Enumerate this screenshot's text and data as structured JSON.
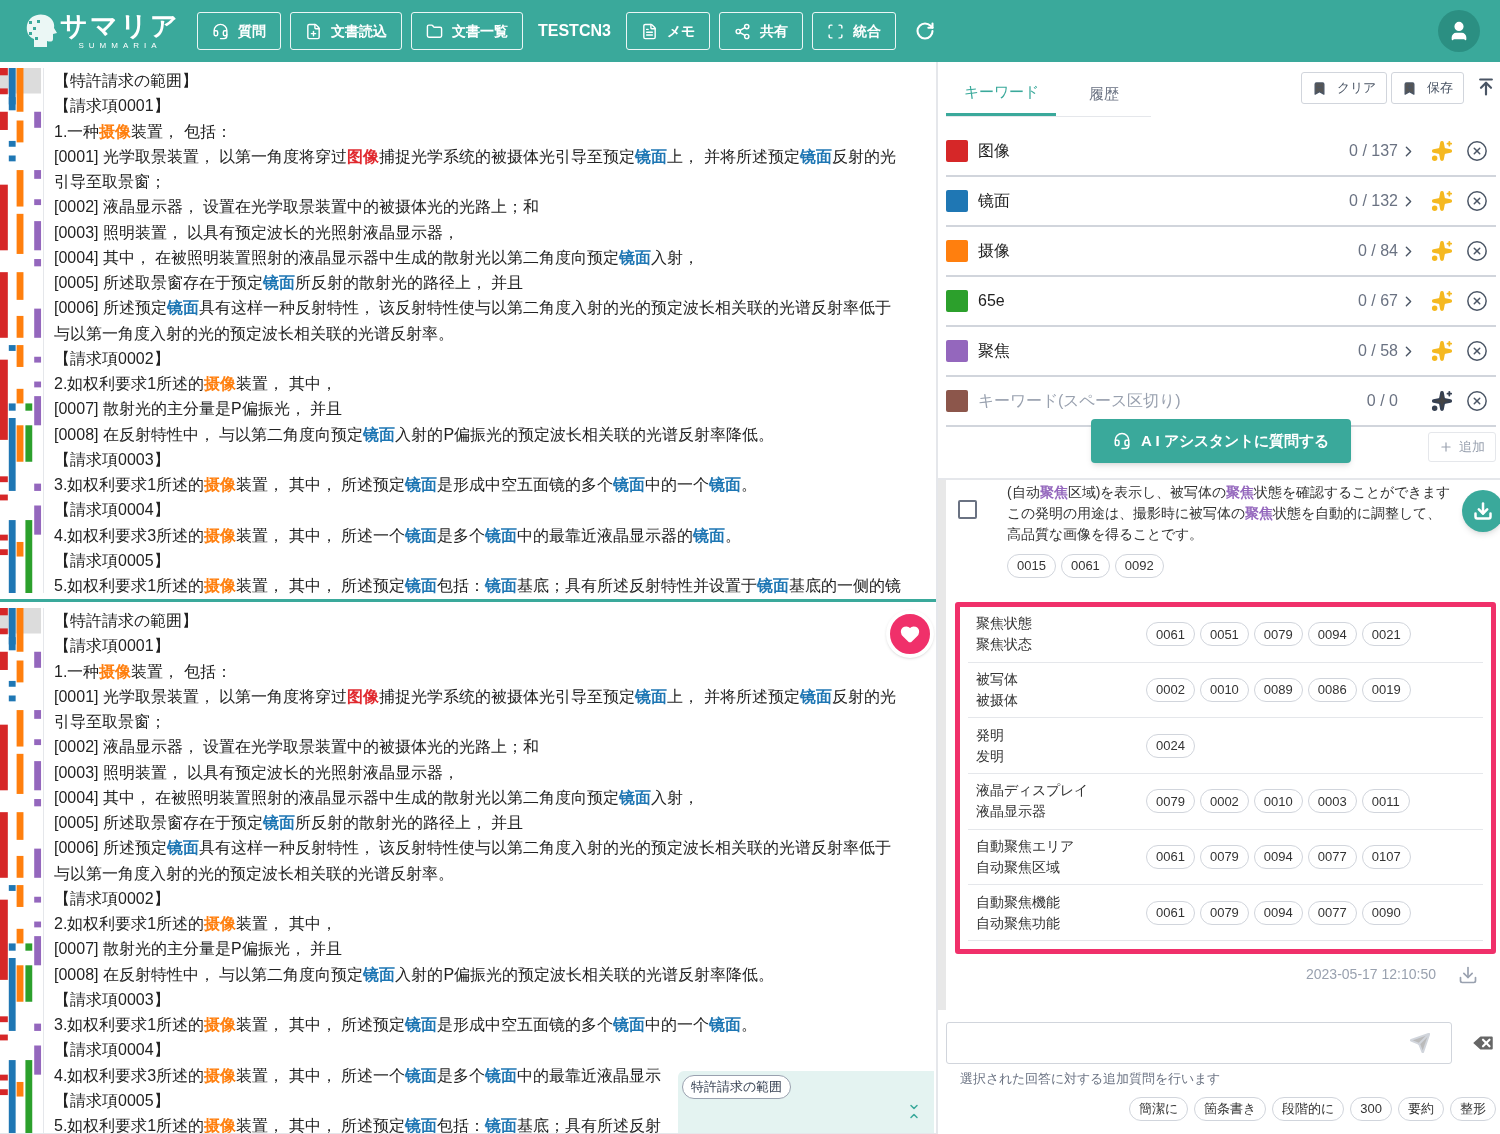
{
  "header": {
    "logo": {
      "name": "サマリア",
      "subtitle": "SUMMARIA"
    },
    "items": [
      {
        "kind": "button",
        "label": "質問"
      },
      {
        "kind": "button",
        "label": "文書読込"
      },
      {
        "kind": "button",
        "label": "文書一覧"
      },
      {
        "kind": "label",
        "label": "TESTCN3"
      },
      {
        "kind": "button",
        "label": "メモ"
      },
      {
        "kind": "button",
        "label": "共有"
      },
      {
        "kind": "button",
        "label": "統合"
      }
    ]
  },
  "documents": [
    {
      "selected": true,
      "lines": [
        [
          {
            "text": "【特許請求の範囲】"
          }
        ],
        [
          {
            "text": "【請求項0001】"
          }
        ],
        [
          {
            "text": "1.一种"
          },
          {
            "text": "摄像",
            "color": "#ff7f0e"
          },
          {
            "text": "装置， 包括："
          }
        ],
        [
          {
            "text": "[0001] 光学取景装置， 以第一角度将穿过"
          },
          {
            "text": "图像",
            "color": "#e0282e"
          },
          {
            "text": "捕捉光学系统的被摄体光引导至预定"
          },
          {
            "text": "镜面",
            "color": "#1f77b4"
          },
          {
            "text": "上， 并将所述预定"
          },
          {
            "text": "镜面",
            "color": "#1f77b4"
          },
          {
            "text": "反射的光"
          }
        ],
        [
          {
            "text": "引导至取景窗；"
          }
        ],
        [
          {
            "text": "[0002] 液晶显示器， 设置在光学取景装置中的被摄体光的光路上；和"
          }
        ],
        [
          {
            "text": "[0003] 照明装置， 以具有预定波长的光照射液晶显示器，"
          }
        ],
        [
          {
            "text": "[0004] 其中， 在被照明装置照射的液晶显示器中生成的散射光以第二角度向预定"
          },
          {
            "text": "镜面",
            "color": "#1f77b4"
          },
          {
            "text": "入射，"
          }
        ],
        [
          {
            "text": "[0005] 所述取景窗存在于预定"
          },
          {
            "text": "镜面",
            "color": "#1f77b4"
          },
          {
            "text": "所反射的散射光的路径上， 并且"
          }
        ],
        [
          {
            "text": "[0006] 所述预定"
          },
          {
            "text": "镜面",
            "color": "#1f77b4"
          },
          {
            "text": "具有这样一种反射特性， 该反射特性使与以第二角度入射的光的预定波长相关联的光谱反射率低于"
          }
        ],
        [
          {
            "text": "与以第一角度入射的光的预定波长相关联的光谱反射率。"
          }
        ],
        [
          {
            "text": "【請求項0002】"
          }
        ],
        [
          {
            "text": "2.如权利要求1所述的"
          },
          {
            "text": "摄像",
            "color": "#ff7f0e"
          },
          {
            "text": "装置， 其中，"
          }
        ],
        [
          {
            "text": "[0007] 散射光的主分量是P偏振光， 并且"
          }
        ],
        [
          {
            "text": "[0008] 在反射特性中， 与以第二角度向预定"
          },
          {
            "text": "镜面",
            "color": "#1f77b4"
          },
          {
            "text": "入射的P偏振光的预定波长相关联的光谱反射率降低。"
          }
        ],
        [
          {
            "text": "【請求項0003】"
          }
        ],
        [
          {
            "text": "3.如权利要求1所述的"
          },
          {
            "text": "摄像",
            "color": "#ff7f0e"
          },
          {
            "text": "装置， 其中， 所述预定"
          },
          {
            "text": "镜面",
            "color": "#1f77b4"
          },
          {
            "text": "是形成中空五面镜的多个"
          },
          {
            "text": "镜面",
            "color": "#1f77b4"
          },
          {
            "text": "中的一个"
          },
          {
            "text": "镜面",
            "color": "#1f77b4"
          },
          {
            "text": "。"
          }
        ],
        [
          {
            "text": "【請求項0004】"
          }
        ],
        [
          {
            "text": "4.如权利要求3所述的"
          },
          {
            "text": "摄像",
            "color": "#ff7f0e"
          },
          {
            "text": "装置， 其中， 所述一个"
          },
          {
            "text": "镜面",
            "color": "#1f77b4"
          },
          {
            "text": "是多个"
          },
          {
            "text": "镜面",
            "color": "#1f77b4"
          },
          {
            "text": "中的最靠近液晶显示器的"
          },
          {
            "text": "镜面",
            "color": "#1f77b4"
          },
          {
            "text": "。"
          }
        ],
        [
          {
            "text": "【請求項0005】"
          }
        ],
        [
          {
            "text": "5.如权利要求1所述的"
          },
          {
            "text": "摄像",
            "color": "#ff7f0e"
          },
          {
            "text": "装置， 其中， 所述预定"
          },
          {
            "text": "镜面",
            "color": "#1f77b4"
          },
          {
            "text": "包括："
          },
          {
            "text": "镜面",
            "color": "#1f77b4"
          },
          {
            "text": "基底；具有所述反射特性并设置于"
          },
          {
            "text": "镜面",
            "color": "#1f77b4"
          },
          {
            "text": "基底的一侧的镜"
          }
        ]
      ]
    },
    {
      "selected": false,
      "lines": [
        [
          {
            "text": "【特許請求の範囲】"
          }
        ],
        [
          {
            "text": "【請求項0001】"
          }
        ],
        [
          {
            "text": "1.一种"
          },
          {
            "text": "摄像",
            "color": "#ff7f0e"
          },
          {
            "text": "装置， 包括："
          }
        ],
        [
          {
            "text": "[0001] 光学取景装置， 以第一角度将穿过"
          },
          {
            "text": "图像",
            "color": "#e0282e"
          },
          {
            "text": "捕捉光学系统的被摄体光引导至预定"
          },
          {
            "text": "镜面",
            "color": "#1f77b4"
          },
          {
            "text": "上， 并将所述预定"
          },
          {
            "text": "镜面",
            "color": "#1f77b4"
          },
          {
            "text": "反射的光"
          }
        ],
        [
          {
            "text": "引导至取景窗；"
          }
        ],
        [
          {
            "text": "[0002] 液晶显示器， 设置在光学取景装置中的被摄体光的光路上；和"
          }
        ],
        [
          {
            "text": "[0003] 照明装置， 以具有预定波长的光照射液晶显示器，"
          }
        ],
        [
          {
            "text": "[0004] 其中， 在被照明装置照射的液晶显示器中生成的散射光以第二角度向预定"
          },
          {
            "text": "镜面",
            "color": "#1f77b4"
          },
          {
            "text": "入射，"
          }
        ],
        [
          {
            "text": "[0005] 所述取景窗存在于预定"
          },
          {
            "text": "镜面",
            "color": "#1f77b4"
          },
          {
            "text": "所反射的散射光的路径上， 并且"
          }
        ],
        [
          {
            "text": "[0006] 所述预定"
          },
          {
            "text": "镜面",
            "color": "#1f77b4"
          },
          {
            "text": "具有这样一种反射特性， 该反射特性使与以第二角度入射的光的预定波长相关联的光谱反射率低于"
          }
        ],
        [
          {
            "text": "与以第一角度入射的光的预定波长相关联的光谱反射率。"
          }
        ],
        [
          {
            "text": "【請求項0002】"
          }
        ],
        [
          {
            "text": "2.如权利要求1所述的"
          },
          {
            "text": "摄像",
            "color": "#ff7f0e"
          },
          {
            "text": "装置， 其中，"
          }
        ],
        [
          {
            "text": "[0007] 散射光的主分量是P偏振光， 并且"
          }
        ],
        [
          {
            "text": "[0008] 在反射特性中， 与以第二角度向预定"
          },
          {
            "text": "镜面",
            "color": "#1f77b4"
          },
          {
            "text": "入射的P偏振光的预定波长相关联的光谱反射率降低。"
          }
        ],
        [
          {
            "text": "【請求項0003】"
          }
        ],
        [
          {
            "text": "3.如权利要求1所述的"
          },
          {
            "text": "摄像",
            "color": "#ff7f0e"
          },
          {
            "text": "装置， 其中， 所述预定"
          },
          {
            "text": "镜面",
            "color": "#1f77b4"
          },
          {
            "text": "是形成中空五面镜的多个"
          },
          {
            "text": "镜面",
            "color": "#1f77b4"
          },
          {
            "text": "中的一个"
          },
          {
            "text": "镜面",
            "color": "#1f77b4"
          },
          {
            "text": "。"
          }
        ],
        [
          {
            "text": "【請求項0004】"
          }
        ],
        [
          {
            "text": "4.如权利要求3所述的"
          },
          {
            "text": "摄像",
            "color": "#ff7f0e"
          },
          {
            "text": "装置， 其中， 所述一个"
          },
          {
            "text": "镜面",
            "color": "#1f77b4"
          },
          {
            "text": "是多个"
          },
          {
            "text": "镜面",
            "color": "#1f77b4"
          },
          {
            "text": "中的最靠近液晶显示"
          }
        ],
        [
          {
            "text": "【請求項0005】"
          }
        ],
        [
          {
            "text": "5.如权利要求1所述的"
          },
          {
            "text": "摄像",
            "color": "#ff7f0e"
          },
          {
            "text": "装置， 其中， 所述预定"
          },
          {
            "text": "镜面",
            "color": "#1f77b4"
          },
          {
            "text": "包括："
          },
          {
            "text": "镜面",
            "color": "#1f77b4"
          },
          {
            "text": "基底；具有所述反射"
          }
        ]
      ],
      "section_popup": {
        "chip": "特許請求の範囲"
      }
    }
  ],
  "keyword_panel": {
    "tabs": [
      {
        "label": "キーワード",
        "selected": true
      },
      {
        "label": "履歴",
        "selected": false
      }
    ],
    "buttons": [
      "クリア",
      "保存"
    ],
    "keywords": [
      {
        "kind": "keyword",
        "name": "图像",
        "count": "0 / 137",
        "color": "#d62728"
      },
      {
        "kind": "keyword",
        "name": "镜面",
        "count": "0 / 132",
        "color": "#1f77b4"
      },
      {
        "kind": "keyword",
        "name": "摄像",
        "count": "0 / 84",
        "color": "#ff7f0e"
      },
      {
        "kind": "keyword",
        "name": "65e",
        "count": "0 / 67",
        "color": "#2ca02c"
      },
      {
        "kind": "keyword",
        "name": "聚焦",
        "count": "0 / 58",
        "color": "#9467bd"
      },
      {
        "kind": "new",
        "placeholder": "キーワード(スペース区切り)",
        "count": "0 / 0",
        "color": "#8c564b"
      }
    ],
    "ask_button": "A I アシスタントに質問する",
    "add_button": {
      "label": "追加",
      "disabled": true
    }
  },
  "answer": {
    "checked": false,
    "lines": [
      [
        {
          "text": "(自动"
        },
        {
          "text": "聚焦",
          "color": "#9467bd"
        },
        {
          "text": "区域)を表示し、被写体の"
        },
        {
          "text": "聚焦",
          "color": "#9467bd"
        },
        {
          "text": "状態を確認することができます"
        }
      ],
      [
        {
          "text": "この発明の用途は、撮影時に被写体の"
        },
        {
          "text": "聚焦",
          "color": "#9467bd"
        },
        {
          "text": "状態を自動的に調整して、"
        }
      ],
      [
        {
          "text": "高品質な画像を得ることです。"
        }
      ]
    ],
    "refs": [
      "0015",
      "0061",
      "0092"
    ]
  },
  "term_table": [
    {
      "ja": "聚焦状態",
      "zh": "聚焦状态",
      "refs": [
        "0061",
        "0051",
        "0079",
        "0094",
        "0021"
      ]
    },
    {
      "ja": "被写体",
      "zh": "被摄体",
      "refs": [
        "0002",
        "0010",
        "0089",
        "0086",
        "0019"
      ]
    },
    {
      "ja": "発明",
      "zh": "发明",
      "refs": [
        "0024"
      ]
    },
    {
      "ja": "液晶ディスプレイ",
      "zh": "液晶显示器",
      "refs": [
        "0079",
        "0002",
        "0010",
        "0003",
        "0011"
      ]
    },
    {
      "ja": "自動聚焦エリア",
      "zh": "自动聚焦区域",
      "refs": [
        "0061",
        "0079",
        "0094",
        "0077",
        "0107"
      ]
    },
    {
      "ja": "自動聚焦機能",
      "zh": "自动聚焦功能",
      "refs": [
        "0061",
        "0079",
        "0094",
        "0077",
        "0090"
      ]
    }
  ],
  "timestamp": "2023-05-17 12:10:50",
  "followup": {
    "hint": "選択された回答に対する追加質問を行います",
    "chips": [
      "簡潔に",
      "箇条書き",
      "段階的に",
      "300",
      "要約",
      "整形"
    ]
  }
}
